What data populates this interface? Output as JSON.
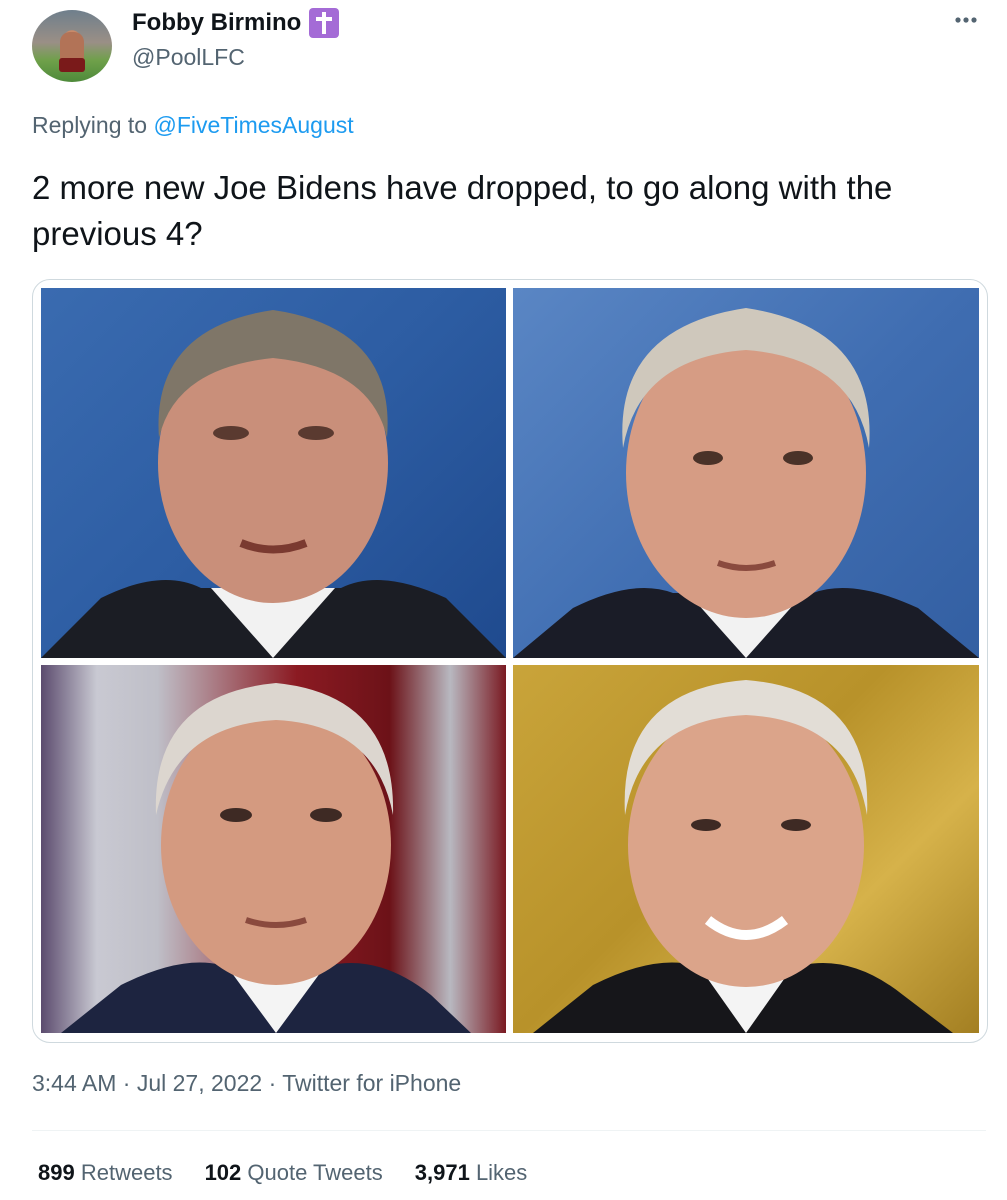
{
  "author": {
    "display_name": "Fobby Birmino",
    "badge_icon": "latin-cross-icon",
    "badge_color": "#a46bd6",
    "handle": "@PoolLFC"
  },
  "reply": {
    "prefix": "Replying to",
    "target": "@FiveTimesAugust"
  },
  "tweet": {
    "text": "2 more new Joe Bidens have dropped, to go along with the previous 4?"
  },
  "media": {
    "count": 4
  },
  "meta": {
    "time": "3:44 AM",
    "date": "Jul 27, 2022",
    "source": "Twitter for iPhone",
    "separator": "·"
  },
  "stats": {
    "retweets_count": "899",
    "retweets_label": "Retweets",
    "quotes_count": "102",
    "quotes_label": "Quote Tweets",
    "likes_count": "3,971",
    "likes_label": "Likes"
  },
  "colors": {
    "link": "#1d9bf0",
    "secondary_text": "#536471",
    "primary_text": "#0f1419"
  }
}
